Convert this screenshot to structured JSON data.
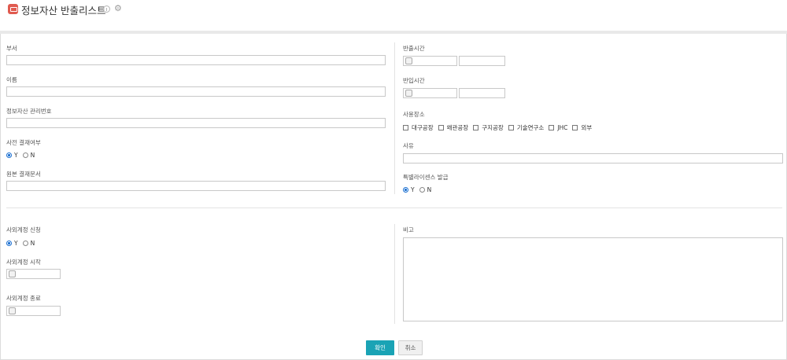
{
  "header": {
    "title": "정보자산 반출리스트",
    "icons": [
      "app-icon",
      "info-icon",
      "gear-icon"
    ]
  },
  "left": {
    "dept_label": "부서",
    "name_label": "이름",
    "asset_no_label": "정보자산 관리번호",
    "pre_approval_label": "사전 결재여부",
    "pre_approval_options": [
      "Y",
      "N"
    ],
    "pre_approval_selected": "Y",
    "orig_doc_label": "원본 결재문서"
  },
  "right": {
    "out_time_label": "반출시간",
    "in_time_label": "반입시간",
    "place_label": "사용장소",
    "places": [
      "대구공장",
      "왜관공장",
      "구지공장",
      "기술연구소",
      "JHC",
      "외부"
    ],
    "reason_label": "사유",
    "license_label": "특별라이센스 발급",
    "license_options": [
      "Y",
      "N"
    ],
    "license_selected": "Y"
  },
  "bottom": {
    "ext_account_label": "사외계정 신청",
    "ext_account_options": [
      "Y",
      "N"
    ],
    "ext_account_selected": "Y",
    "ext_start_label": "사외계정 시작",
    "ext_end_label": "사외계정 종료",
    "note_label": "비고"
  },
  "buttons": {
    "confirm": "확인",
    "cancel": "취소"
  },
  "colors": {
    "accent": "#1aa3b5",
    "app_icon": "#e05a4f",
    "radio_on": "#1a6fd1"
  }
}
